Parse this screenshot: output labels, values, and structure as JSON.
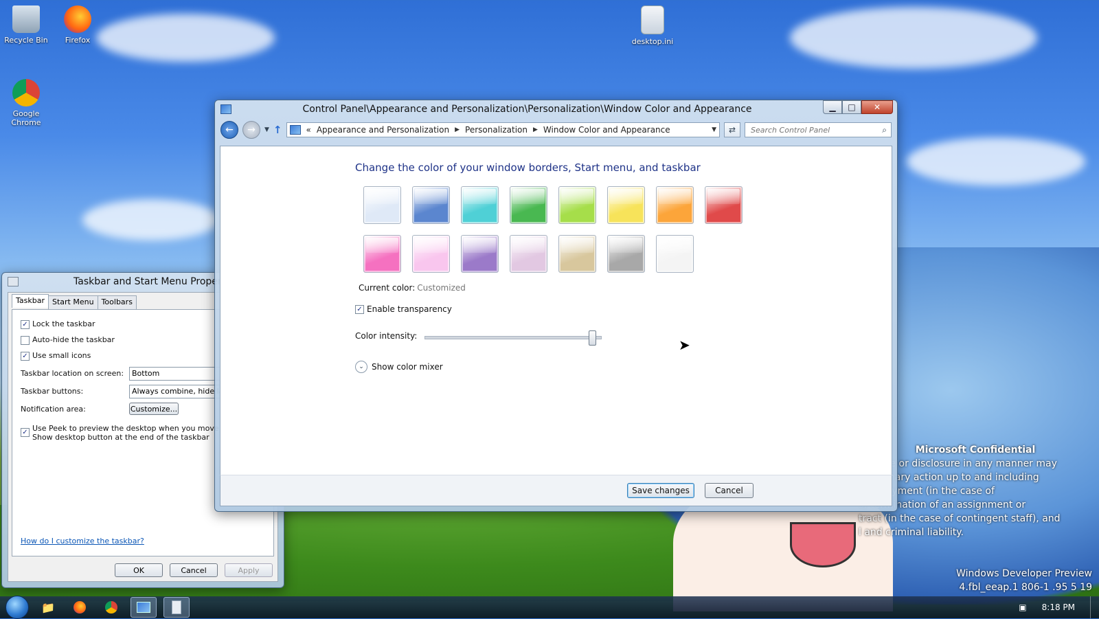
{
  "desktop": {
    "icons": [
      {
        "label": "Recycle Bin"
      },
      {
        "label": "Firefox"
      },
      {
        "label": "desktop.ini"
      },
      {
        "label": "Google Chrome"
      }
    ],
    "watermark": {
      "title": "Microsoft Confidential",
      "lines": [
        "zed use or disclosure in any manner may",
        "iscip linary action up to and including",
        "n mployment (in the case of",
        "s) termination of an assignment or",
        "tract (in the case of contingent staff), and",
        "l and criminal liability."
      ],
      "build_1": "Windows Developer Preview",
      "build_2": "4.fbl_eeap.1 806-1 .95 5 19"
    }
  },
  "main_window": {
    "title": "Control Panel\\Appearance and Personalization\\Personalization\\Window Color and Appearance",
    "address": {
      "overflow": "«",
      "crumbs": [
        "Appearance and Personalization",
        "Personalization",
        "Window Color and Appearance"
      ]
    },
    "search_placeholder": "Search Control Panel",
    "heading": "Change the color of your window borders, Start menu, and taskbar",
    "swatches_row1": [
      "#dfe9f7",
      "#5b86cf",
      "#4fd0d6",
      "#49b851",
      "#a6de4a",
      "#f7e35a",
      "#fca53a",
      "#e04a4a"
    ],
    "swatches_row2": [
      "#f571c0",
      "#f9c6ee",
      "#9b7ac9",
      "#e2c8e2",
      "#d8c79d",
      "#a8a8a8",
      "#f4f4f4"
    ],
    "current_color_label": "Current color:",
    "current_color_value": "Customized",
    "enable_transparency": "Enable transparency",
    "enable_transparency_checked": true,
    "color_intensity_label": "Color intensity:",
    "color_intensity": 0.97,
    "show_mixer": "Show color mixer",
    "save_label": "Save changes",
    "cancel_label": "Cancel"
  },
  "taskbar_props": {
    "title": "Taskbar and Start Menu Properties",
    "tabs": [
      "Taskbar",
      "Start Menu",
      "Toolbars"
    ],
    "lock": "Lock the taskbar",
    "autohide": "Auto-hide the taskbar",
    "small_icons": "Use small icons",
    "location_label": "Taskbar location on screen:",
    "location_value": "Bottom",
    "buttons_label": "Taskbar buttons:",
    "buttons_value": "Always combine, hide labels",
    "notification_label": "Notification area:",
    "customize_label": "Customize...",
    "peek_line1": "Use Peek to preview the desktop when you move your",
    "peek_line2": "Show desktop button at the end of the taskbar",
    "help_link": "How do I customize the taskbar?",
    "ok": "OK",
    "cancel": "Cancel",
    "apply": "Apply"
  },
  "taskbar": {
    "clock": "8:18 PM"
  }
}
